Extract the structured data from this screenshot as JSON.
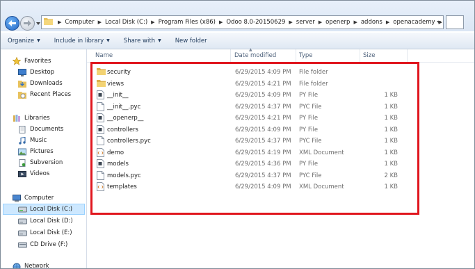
{
  "address": {
    "crumbs": [
      "Computer",
      "Local Disk (C:)",
      "Program Files (x86)",
      "Odoo 8.0-20150629",
      "server",
      "openerp",
      "addons",
      "openacademy"
    ]
  },
  "toolbar": {
    "organize": "Organize",
    "include": "Include in library",
    "share": "Share with",
    "new_folder": "New folder"
  },
  "navpane": {
    "favorites_label": "Favorites",
    "favorites": [
      "Desktop",
      "Downloads",
      "Recent Places"
    ],
    "libraries_label": "Libraries",
    "libraries": [
      "Documents",
      "Music",
      "Pictures",
      "Subversion",
      "Videos"
    ],
    "computer_label": "Computer",
    "drives": [
      "Local Disk (C:)",
      "Local Disk (D:)",
      "Local Disk (E:)",
      "CD Drive (F:)"
    ],
    "network_label": "Network"
  },
  "columns": {
    "name": "Name",
    "date": "Date modified",
    "type": "Type",
    "size": "Size"
  },
  "files": [
    {
      "name": "security",
      "date": "6/29/2015 4:09 PM",
      "type": "File folder",
      "size": "",
      "icon": "folder-icon"
    },
    {
      "name": "views",
      "date": "6/29/2015 4:21 PM",
      "type": "File folder",
      "size": "",
      "icon": "folder-icon"
    },
    {
      "name": "__init__",
      "date": "6/29/2015 4:09 PM",
      "type": "PY File",
      "size": "1 KB",
      "icon": "py-file-icon"
    },
    {
      "name": "__init__.pyc",
      "date": "6/29/2015 4:37 PM",
      "type": "PYC File",
      "size": "1 KB",
      "icon": "file-icon"
    },
    {
      "name": "__openerp__",
      "date": "6/29/2015 4:21 PM",
      "type": "PY File",
      "size": "1 KB",
      "icon": "py-file-icon"
    },
    {
      "name": "controllers",
      "date": "6/29/2015 4:09 PM",
      "type": "PY File",
      "size": "1 KB",
      "icon": "py-file-icon"
    },
    {
      "name": "controllers.pyc",
      "date": "6/29/2015 4:37 PM",
      "type": "PYC File",
      "size": "1 KB",
      "icon": "file-icon"
    },
    {
      "name": "demo",
      "date": "6/29/2015 4:19 PM",
      "type": "XML Document",
      "size": "1 KB",
      "icon": "xml-file-icon"
    },
    {
      "name": "models",
      "date": "6/29/2015 4:36 PM",
      "type": "PY File",
      "size": "1 KB",
      "icon": "py-file-icon"
    },
    {
      "name": "models.pyc",
      "date": "6/29/2015 4:37 PM",
      "type": "PYC File",
      "size": "2 KB",
      "icon": "file-icon"
    },
    {
      "name": "templates",
      "date": "6/29/2015 4:09 PM",
      "type": "XML Document",
      "size": "1 KB",
      "icon": "xml-file-icon"
    }
  ],
  "colors": {
    "highlight": "#e0161e",
    "selection": "#cde8ff"
  }
}
